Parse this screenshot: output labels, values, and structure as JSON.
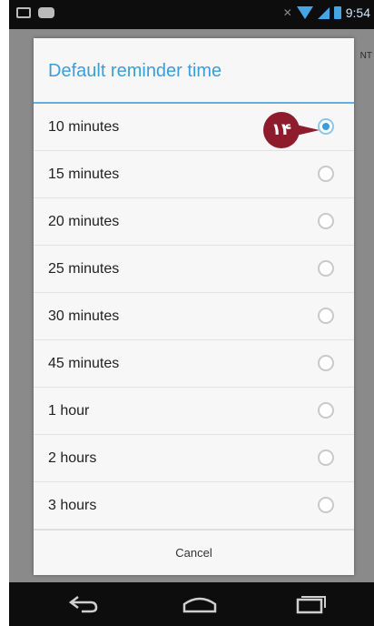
{
  "status_bar": {
    "time": "9:54",
    "icons": [
      "mail-icon",
      "gamepad-icon",
      "no-signal-icon",
      "wifi-icon",
      "cell-signal-icon",
      "battery-icon"
    ]
  },
  "behind": {
    "action_text": "NT"
  },
  "dialog": {
    "title": "Default reminder time",
    "accent_color": "#3b9ed8",
    "options": [
      {
        "label": "10 minutes",
        "selected": true
      },
      {
        "label": "15 minutes",
        "selected": false
      },
      {
        "label": "20 minutes",
        "selected": false
      },
      {
        "label": "25 minutes",
        "selected": false
      },
      {
        "label": "30 minutes",
        "selected": false
      },
      {
        "label": "45 minutes",
        "selected": false
      },
      {
        "label": "1 hour",
        "selected": false
      },
      {
        "label": "2 hours",
        "selected": false
      },
      {
        "label": "3 hours",
        "selected": false
      }
    ],
    "cancel_label": "Cancel"
  },
  "callout": {
    "text": "۱۴",
    "color": "#8f1c2c"
  },
  "nav_bar": {
    "icons": [
      "back-icon",
      "home-icon",
      "recent-apps-icon"
    ]
  }
}
